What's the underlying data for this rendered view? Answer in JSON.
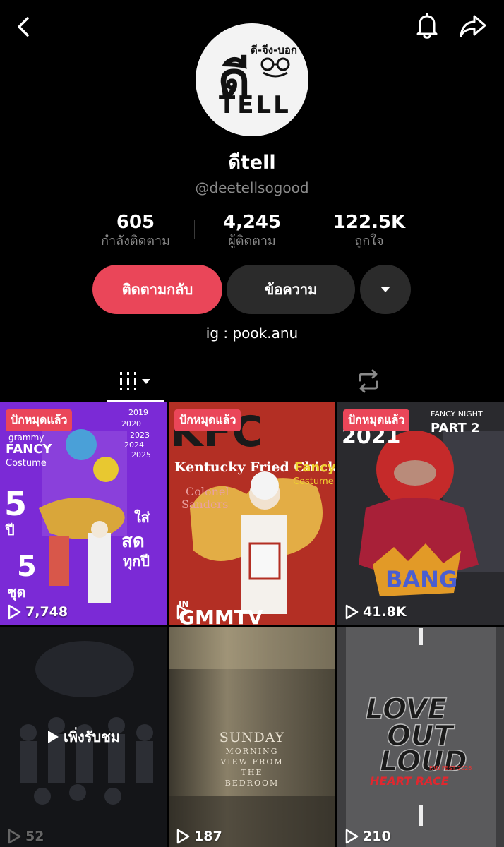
{
  "profile": {
    "display_name": "ดีtell",
    "handle": "@deetellsogood",
    "bio": "ig : pook.anu",
    "avatar_text_main": "TELL",
    "avatar_text_top": "ดี-จีง-บอก",
    "avatar_text_big": "ดี"
  },
  "stats": [
    {
      "value": "605",
      "label": "กำลังติดตาม"
    },
    {
      "value": "4,245",
      "label": "ผู้ติดตาม"
    },
    {
      "value": "122.5K",
      "label": "ถูกใจ"
    }
  ],
  "actions": {
    "follow_back": "ติดตามกลับ",
    "message": "ข้อความ"
  },
  "colors": {
    "accent": "#ea4659",
    "background": "#000000",
    "secondary_button": "#2b2b2b",
    "muted_text": "#8a8a8a"
  },
  "videos": [
    {
      "pinned": "ปักหมุดแล้ว",
      "views": "7,748",
      "texts": [
        "5",
        "ปี",
        "5",
        "ชุด",
        "ใส่",
        "สด",
        "ทุกปี",
        "FANCY",
        "Costume",
        "grammy",
        "2019",
        "2020",
        "2023",
        "2024",
        "2025"
      ]
    },
    {
      "pinned": "ปักหมุดแล้ว",
      "views": "",
      "texts": [
        "KFC",
        "Kentucky Fried Chicken",
        "Colonel",
        "Sanders",
        "Fancy",
        "Costume",
        "IN",
        "GMMTV"
      ]
    },
    {
      "pinned": "ปักหมุดแล้ว",
      "views": "41.8K",
      "texts": [
        "2021",
        "FANCY NIGHT",
        "PART 2",
        "BANG"
      ]
    },
    {
      "recently_watched": "เพิ่งรับชม",
      "views": "52"
    },
    {
      "views": "187",
      "title_lines": [
        "SUNDAY",
        "MORNING",
        "VIEW FROM",
        "THE",
        "BEDROOM"
      ]
    },
    {
      "views": "210",
      "texts": [
        "LOVE",
        "OUT",
        "LOUD",
        "FAN FEST 2026",
        "HEART RACE"
      ]
    }
  ]
}
